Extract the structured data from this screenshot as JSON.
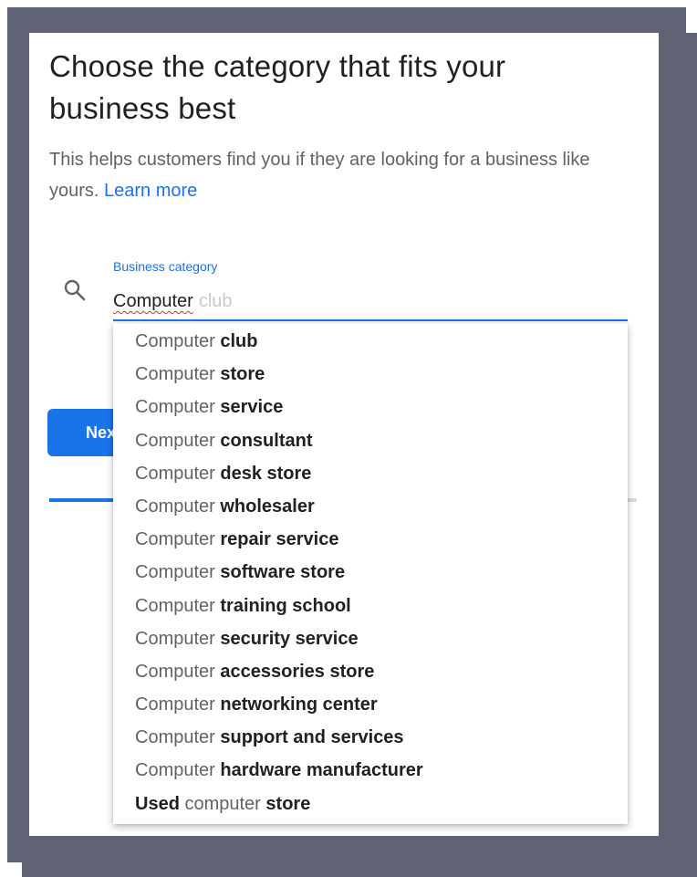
{
  "colors": {
    "accent": "#1a73e8",
    "frame": "#5f6374",
    "spellcheck": "#d93025"
  },
  "page": {
    "title": "Choose the category that fits your business best",
    "description": "This helps customers find you if they are looking for a business like yours.",
    "learn_more": "Learn more"
  },
  "search": {
    "icon": "search-icon",
    "label": "Business category",
    "typed_value": "Computer",
    "autocomplete_hint": "club"
  },
  "next_button": {
    "label": "Next"
  },
  "progress": {
    "fraction": 0.18
  },
  "suggestions": [
    {
      "pre": "",
      "match": "Computer",
      "post": "club"
    },
    {
      "pre": "",
      "match": "Computer",
      "post": "store"
    },
    {
      "pre": "",
      "match": "Computer",
      "post": "service"
    },
    {
      "pre": "",
      "match": "Computer",
      "post": "consultant"
    },
    {
      "pre": "",
      "match": "Computer",
      "post": "desk store"
    },
    {
      "pre": "",
      "match": "Computer",
      "post": "wholesaler"
    },
    {
      "pre": "",
      "match": "Computer",
      "post": "repair service"
    },
    {
      "pre": "",
      "match": "Computer",
      "post": "software store"
    },
    {
      "pre": "",
      "match": "Computer",
      "post": "training school"
    },
    {
      "pre": "",
      "match": "Computer",
      "post": "security service"
    },
    {
      "pre": "",
      "match": "Computer",
      "post": "accessories store"
    },
    {
      "pre": "",
      "match": "Computer",
      "post": "networking center"
    },
    {
      "pre": "",
      "match": "Computer",
      "post": "support and services"
    },
    {
      "pre": "",
      "match": "Computer",
      "post": "hardware manufacturer"
    },
    {
      "pre": "Used",
      "match": "computer",
      "post": "store"
    }
  ]
}
